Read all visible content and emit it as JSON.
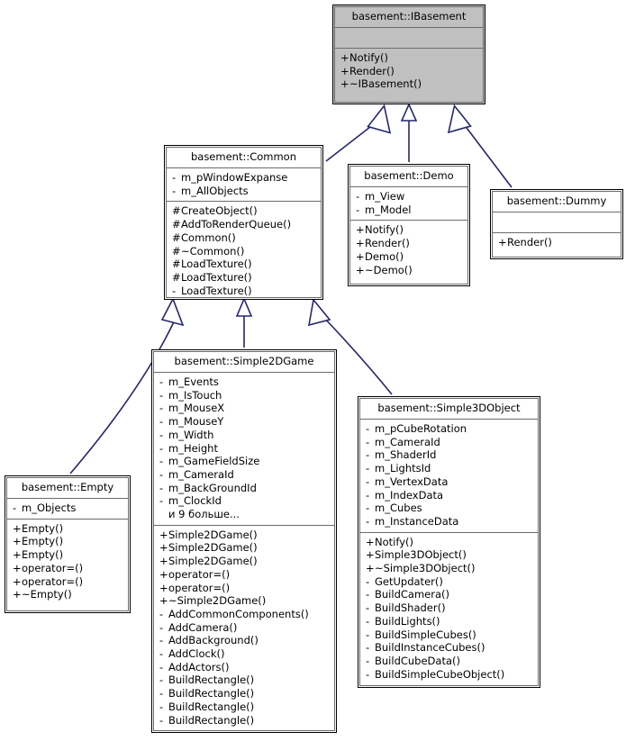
{
  "diagram": {
    "kind": "uml-class-inheritance-diagram",
    "line_color": "#26266e",
    "fill_abstract": "#c0c0c0",
    "fill_default": "#ffffff",
    "border_color": "#000000"
  },
  "classes": {
    "ibasement": {
      "name": "basement::IBasement",
      "attributes": [],
      "methods": [
        {
          "vis": "+",
          "label": "Notify()"
        },
        {
          "vis": "+",
          "label": "Render()"
        },
        {
          "vis": "+",
          "label": "~IBasement()"
        }
      ]
    },
    "common": {
      "name": "basement::Common",
      "attributes": [
        {
          "vis": "-",
          "label": "m_pWindowExpanse"
        },
        {
          "vis": "-",
          "label": "m_AllObjects"
        }
      ],
      "methods": [
        {
          "vis": "#",
          "label": "CreateObject()"
        },
        {
          "vis": "#",
          "label": "AddToRenderQueue()"
        },
        {
          "vis": "#",
          "label": "Common()"
        },
        {
          "vis": "#",
          "label": "~Common()"
        },
        {
          "vis": "#",
          "label": "LoadTexture()"
        },
        {
          "vis": "#",
          "label": "LoadTexture()"
        },
        {
          "vis": "-",
          "label": "LoadTexture()"
        }
      ]
    },
    "demo": {
      "name": "basement::Demo",
      "attributes": [
        {
          "vis": "-",
          "label": "m_View"
        },
        {
          "vis": "-",
          "label": "m_Model"
        }
      ],
      "methods": [
        {
          "vis": "+",
          "label": "Notify()"
        },
        {
          "vis": "+",
          "label": "Render()"
        },
        {
          "vis": "+",
          "label": "Demo()"
        },
        {
          "vis": "+",
          "label": "~Demo()"
        }
      ]
    },
    "dummy": {
      "name": "basement::Dummy",
      "attributes": [],
      "methods": [
        {
          "vis": "+",
          "label": "Render()"
        }
      ]
    },
    "empty": {
      "name": "basement::Empty",
      "attributes": [
        {
          "vis": "-",
          "label": "m_Objects"
        }
      ],
      "methods": [
        {
          "vis": "+",
          "label": "Empty()"
        },
        {
          "vis": "+",
          "label": "Empty()"
        },
        {
          "vis": "+",
          "label": "Empty()"
        },
        {
          "vis": "+",
          "label": "operator=()"
        },
        {
          "vis": "+",
          "label": "operator=()"
        },
        {
          "vis": "+",
          "label": "~Empty()"
        }
      ]
    },
    "simple2dgame": {
      "name": "basement::Simple2DGame",
      "attributes": [
        {
          "vis": "-",
          "label": "m_Events"
        },
        {
          "vis": "-",
          "label": "m_IsTouch"
        },
        {
          "vis": "-",
          "label": "m_MouseX"
        },
        {
          "vis": "-",
          "label": "m_MouseY"
        },
        {
          "vis": "-",
          "label": "m_Width"
        },
        {
          "vis": "-",
          "label": "m_Height"
        },
        {
          "vis": "-",
          "label": "m_GameFieldSize"
        },
        {
          "vis": "-",
          "label": "m_CameraId"
        },
        {
          "vis": "-",
          "label": "m_BackGroundId"
        },
        {
          "vis": "-",
          "label": "m_ClockId"
        },
        {
          "vis": "",
          "label": "и 9 больше..."
        }
      ],
      "methods": [
        {
          "vis": "+",
          "label": "Simple2DGame()"
        },
        {
          "vis": "+",
          "label": "Simple2DGame()"
        },
        {
          "vis": "+",
          "label": "Simple2DGame()"
        },
        {
          "vis": "+",
          "label": "operator=()"
        },
        {
          "vis": "+",
          "label": "operator=()"
        },
        {
          "vis": "+",
          "label": "~Simple2DGame()"
        },
        {
          "vis": "-",
          "label": "AddCommonComponents()"
        },
        {
          "vis": "-",
          "label": "AddCamera()"
        },
        {
          "vis": "-",
          "label": "AddBackground()"
        },
        {
          "vis": "-",
          "label": "AddClock()"
        },
        {
          "vis": "-",
          "label": "AddActors()"
        },
        {
          "vis": "-",
          "label": "BuildRectangle()"
        },
        {
          "vis": "-",
          "label": "BuildRectangle()"
        },
        {
          "vis": "-",
          "label": "BuildRectangle()"
        },
        {
          "vis": "-",
          "label": "BuildRectangle()"
        }
      ]
    },
    "simple3dobject": {
      "name": "basement::Simple3DObject",
      "attributes": [
        {
          "vis": "-",
          "label": "m_pCubeRotation"
        },
        {
          "vis": "-",
          "label": "m_CameraId"
        },
        {
          "vis": "-",
          "label": "m_ShaderId"
        },
        {
          "vis": "-",
          "label": "m_LightsId"
        },
        {
          "vis": "-",
          "label": "m_VertexData"
        },
        {
          "vis": "-",
          "label": "m_IndexData"
        },
        {
          "vis": "-",
          "label": "m_Cubes"
        },
        {
          "vis": "-",
          "label": "m_InstanceData"
        }
      ],
      "methods": [
        {
          "vis": "+",
          "label": "Notify()"
        },
        {
          "vis": "+",
          "label": "Simple3DObject()"
        },
        {
          "vis": "+",
          "label": "~Simple3DObject()"
        },
        {
          "vis": "-",
          "label": "GetUpdater()"
        },
        {
          "vis": "-",
          "label": "BuildCamera()"
        },
        {
          "vis": "-",
          "label": "BuildShader()"
        },
        {
          "vis": "-",
          "label": "BuildLights()"
        },
        {
          "vis": "-",
          "label": "BuildSimpleCubes()"
        },
        {
          "vis": "-",
          "label": "BuildInstanceCubes()"
        },
        {
          "vis": "-",
          "label": "BuildCubeData()"
        },
        {
          "vis": "-",
          "label": "BuildSimpleCubeObject()"
        }
      ]
    }
  },
  "edges": [
    {
      "from": "common",
      "to": "ibasement",
      "type": "generalization"
    },
    {
      "from": "demo",
      "to": "ibasement",
      "type": "generalization"
    },
    {
      "from": "dummy",
      "to": "ibasement",
      "type": "generalization"
    },
    {
      "from": "empty",
      "to": "common",
      "type": "generalization"
    },
    {
      "from": "simple2dgame",
      "to": "common",
      "type": "generalization"
    },
    {
      "from": "simple3dobject",
      "to": "common",
      "type": "generalization"
    }
  ]
}
